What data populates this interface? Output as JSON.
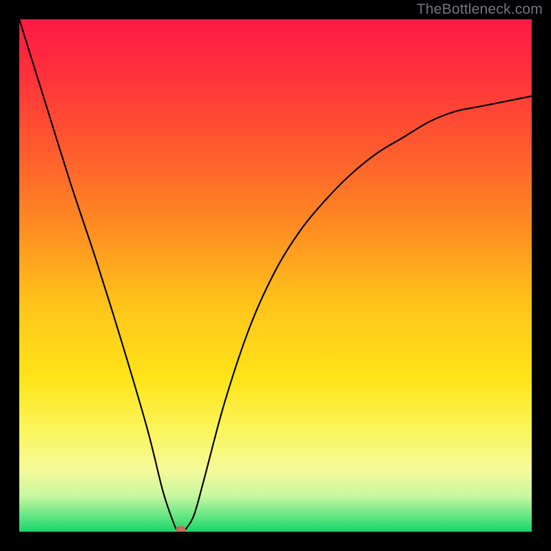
{
  "watermark": "TheBottleneck.com",
  "chart_data": {
    "type": "line",
    "title": "",
    "xlabel": "",
    "ylabel": "",
    "xlim": [
      0,
      100
    ],
    "ylim": [
      0,
      100
    ],
    "series": [
      {
        "name": "bottleneck-curve",
        "x": [
          0,
          5,
          10,
          15,
          20,
          25,
          28,
          30,
          31,
          32,
          34,
          36,
          40,
          45,
          50,
          55,
          60,
          65,
          70,
          75,
          80,
          85,
          90,
          95,
          100
        ],
        "values": [
          100,
          84,
          68,
          53,
          37,
          20,
          8,
          2,
          0,
          0,
          3,
          10,
          25,
          40,
          51,
          59,
          65,
          70,
          74,
          77,
          80,
          82,
          83,
          84,
          85
        ]
      }
    ],
    "minimum_marker": {
      "x": 31.5,
      "y": 0,
      "color": "#c46a5a"
    },
    "gradient_stops": [
      {
        "offset": 0.0,
        "color": "#ff1a44"
      },
      {
        "offset": 0.1,
        "color": "#ff2f3c"
      },
      {
        "offset": 0.25,
        "color": "#ff5a2e"
      },
      {
        "offset": 0.4,
        "color": "#ff8a22"
      },
      {
        "offset": 0.55,
        "color": "#ffc21a"
      },
      {
        "offset": 0.7,
        "color": "#ffe418"
      },
      {
        "offset": 0.8,
        "color": "#faf55a"
      },
      {
        "offset": 0.88,
        "color": "#f5fa9a"
      },
      {
        "offset": 0.93,
        "color": "#c8f7a0"
      },
      {
        "offset": 0.965,
        "color": "#6fe887"
      },
      {
        "offset": 1.0,
        "color": "#17d56b"
      }
    ]
  }
}
